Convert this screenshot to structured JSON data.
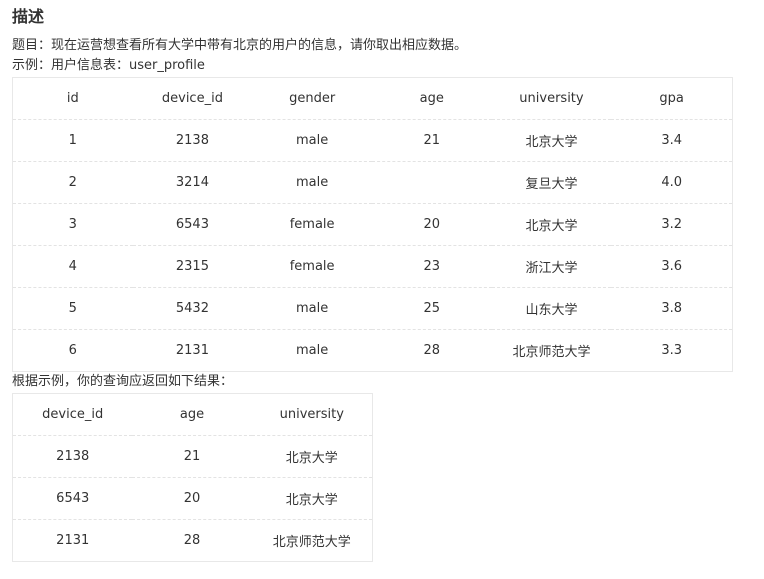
{
  "heading": "描述",
  "question": "题目：现在运营想查看所有大学中带有北京的用户的信息，请你取出相应数据。",
  "example_label": "示例：用户信息表：user_profile",
  "table1": {
    "headers": [
      "id",
      "device_id",
      "gender",
      "age",
      "university",
      "gpa"
    ],
    "rows": [
      [
        "1",
        "2138",
        "male",
        "21",
        "北京大学",
        "3.4"
      ],
      [
        "2",
        "3214",
        "male",
        "",
        "复旦大学",
        "4.0"
      ],
      [
        "3",
        "6543",
        "female",
        "20",
        "北京大学",
        "3.2"
      ],
      [
        "4",
        "2315",
        "female",
        "23",
        "浙江大学",
        "3.6"
      ],
      [
        "5",
        "5432",
        "male",
        "25",
        "山东大学",
        "3.8"
      ],
      [
        "6",
        "2131",
        "male",
        "28",
        "北京师范大学",
        "3.3"
      ]
    ]
  },
  "result_label": "根据示例，你的查询应返回如下结果：",
  "table2": {
    "headers": [
      "device_id",
      "age",
      "university"
    ],
    "rows": [
      [
        "2138",
        "21",
        "北京大学"
      ],
      [
        "6543",
        "20",
        "北京大学"
      ],
      [
        "2131",
        "28",
        "北京师范大学"
      ]
    ]
  }
}
